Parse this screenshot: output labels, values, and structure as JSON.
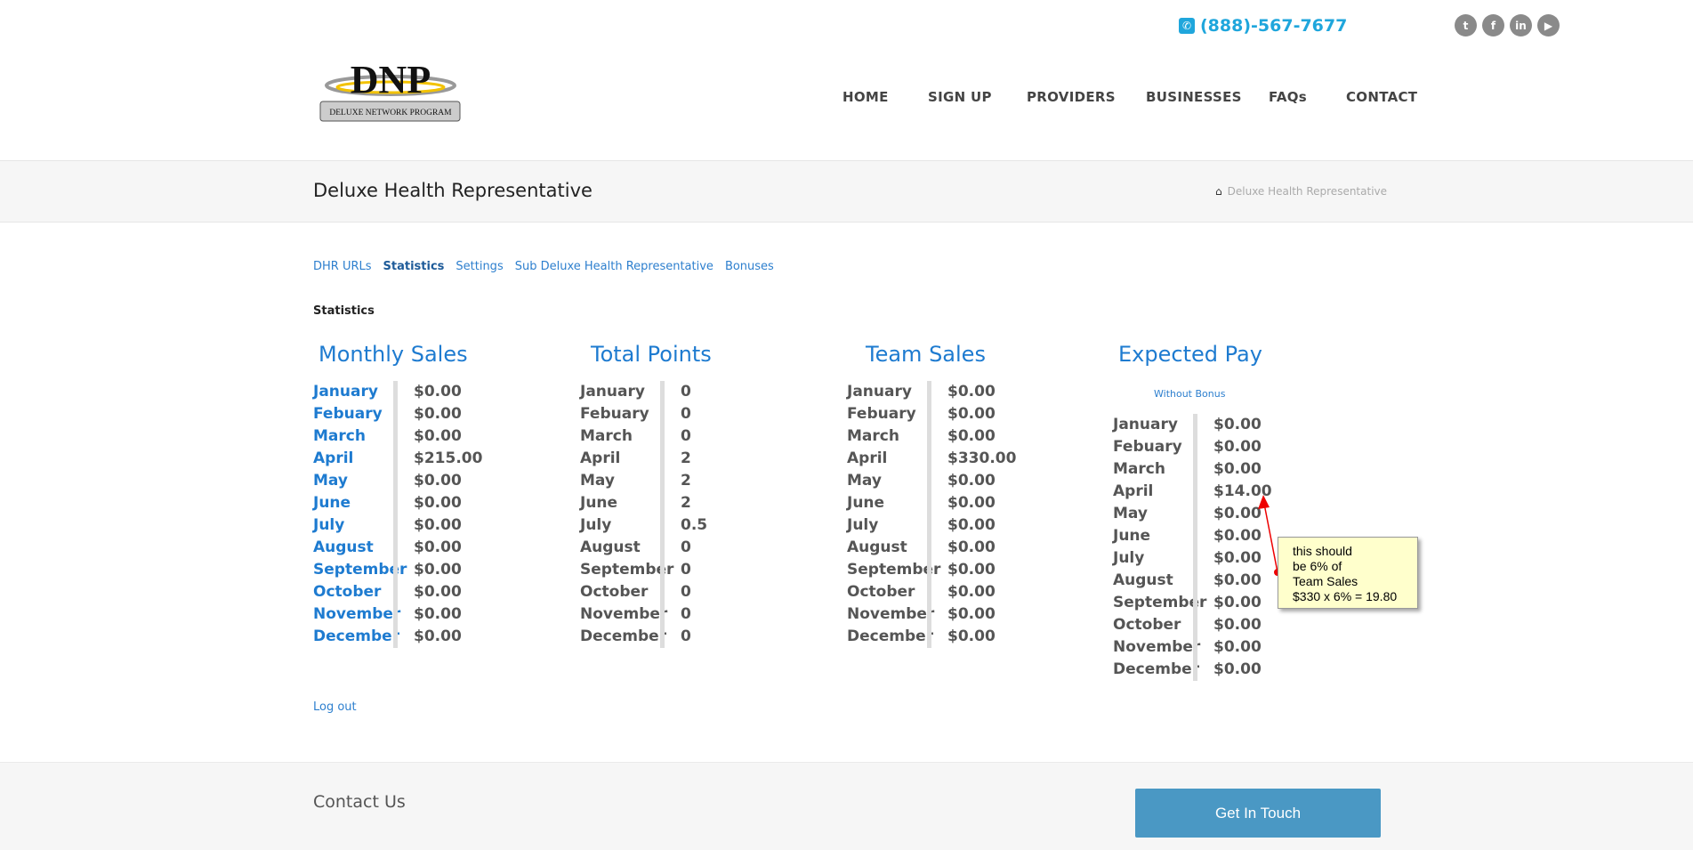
{
  "header": {
    "phone": "(888)-567-7677",
    "social": [
      "twitter",
      "facebook",
      "linkedin",
      "youtube"
    ],
    "logo_text": "DNP",
    "logo_sub": "DELUXE NETWORK PROGRAM",
    "nav": [
      "HOME",
      "SIGN UP",
      "PROVIDERS",
      "BUSINESSES",
      "FAQs",
      "CONTACT"
    ]
  },
  "page": {
    "title": "Deluxe Health Representative",
    "breadcrumb": "Deluxe Health Representative"
  },
  "tabs": [
    "DHR URLs",
    "Statistics",
    "Settings",
    "Sub Deluxe Health Representative",
    "Bonuses"
  ],
  "section_title": "Statistics",
  "months": [
    "January",
    "Febuary",
    "March",
    "April",
    "May",
    "June",
    "July",
    "August",
    "September",
    "October",
    "November",
    "December"
  ],
  "tables": [
    {
      "title": "Monthly Sales",
      "values": [
        "$0.00",
        "$0.00",
        "$0.00",
        "$215.00",
        "$0.00",
        "$0.00",
        "$0.00",
        "$0.00",
        "$0.00",
        "$0.00",
        "$0.00",
        "$0.00"
      ]
    },
    {
      "title": "Total Points",
      "values": [
        "0",
        "0",
        "0",
        "2",
        "2",
        "2",
        "0.5",
        "0",
        "0",
        "0",
        "0",
        "0"
      ]
    },
    {
      "title": "Team Sales",
      "values": [
        "$0.00",
        "$0.00",
        "$0.00",
        "$330.00",
        "$0.00",
        "$0.00",
        "$0.00",
        "$0.00",
        "$0.00",
        "$0.00",
        "$0.00",
        "$0.00"
      ]
    },
    {
      "title": "Expected Pay",
      "subtitle": "Without Bonus",
      "values": [
        "$0.00",
        "$0.00",
        "$0.00",
        "$14.00",
        "$0.00",
        "$0.00",
        "$0.00",
        "$0.00",
        "$0.00",
        "$0.00",
        "$0.00",
        "$0.00"
      ]
    }
  ],
  "annotation": [
    "this should",
    "be 6% of",
    "Team Sales",
    "$330 x 6% = 19.80"
  ],
  "logout": "Log out",
  "footer": {
    "contact": "Contact Us",
    "button": "Get In Touch"
  }
}
